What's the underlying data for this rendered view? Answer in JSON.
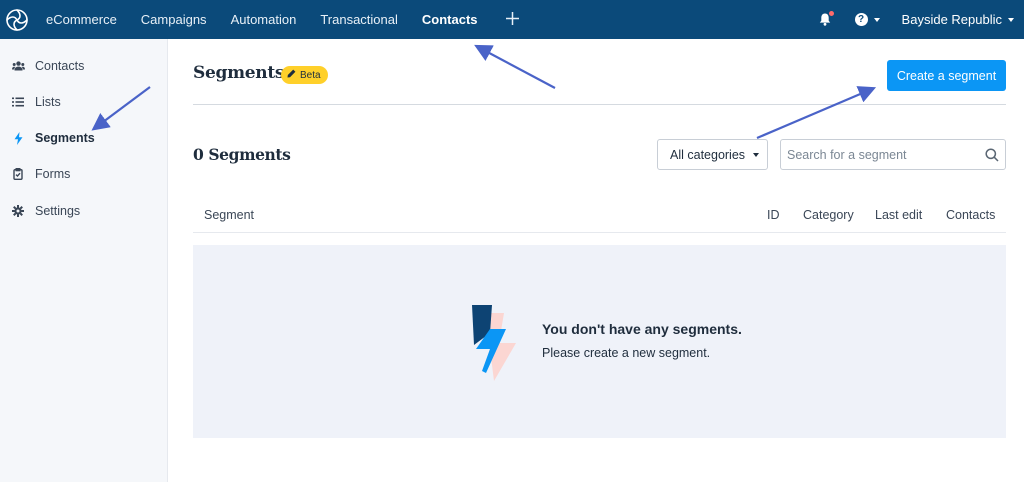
{
  "top_nav": {
    "logo_icon": "sendinblue-logo-icon",
    "items": [
      {
        "label": "eCommerce"
      },
      {
        "label": "Campaigns"
      },
      {
        "label": "Automation"
      },
      {
        "label": "Transactional"
      },
      {
        "label": "Contacts",
        "active": true
      }
    ],
    "add_icon": "plus-icon",
    "notification_icon": "bell-icon",
    "help_icon": "question-circle-icon",
    "account_label": "Bayside Republic"
  },
  "sidebar": {
    "items": [
      {
        "label": "Contacts",
        "icon": "users-icon"
      },
      {
        "label": "Lists",
        "icon": "list-icon"
      },
      {
        "label": "Segments",
        "icon": "lightning-icon",
        "active": true
      },
      {
        "label": "Forms",
        "icon": "clipboard-icon"
      },
      {
        "label": "Settings",
        "icon": "gear-icon"
      }
    ]
  },
  "header": {
    "title": "Segments",
    "badge": "Beta",
    "badge_icon": "pencil-icon",
    "create_button": "Create a segment"
  },
  "toolbar": {
    "count_label": "0 Segments",
    "category_select": "All categories",
    "search_placeholder": "Search for a segment",
    "search_icon": "search-icon"
  },
  "table": {
    "columns": [
      "Segment",
      "ID",
      "Category",
      "Last edit",
      "Contacts"
    ],
    "rows": []
  },
  "empty_state": {
    "icon": "lightning-illustration-icon",
    "title": "You don't have any segments.",
    "subtitle": "Please create a new segment."
  },
  "colors": {
    "nav_bg": "#0b4a7a",
    "primary": "#0b96f5",
    "badge": "#ffd02a",
    "annotation_arrow": "#4a63c8",
    "empty_bg": "#eff2f9"
  }
}
